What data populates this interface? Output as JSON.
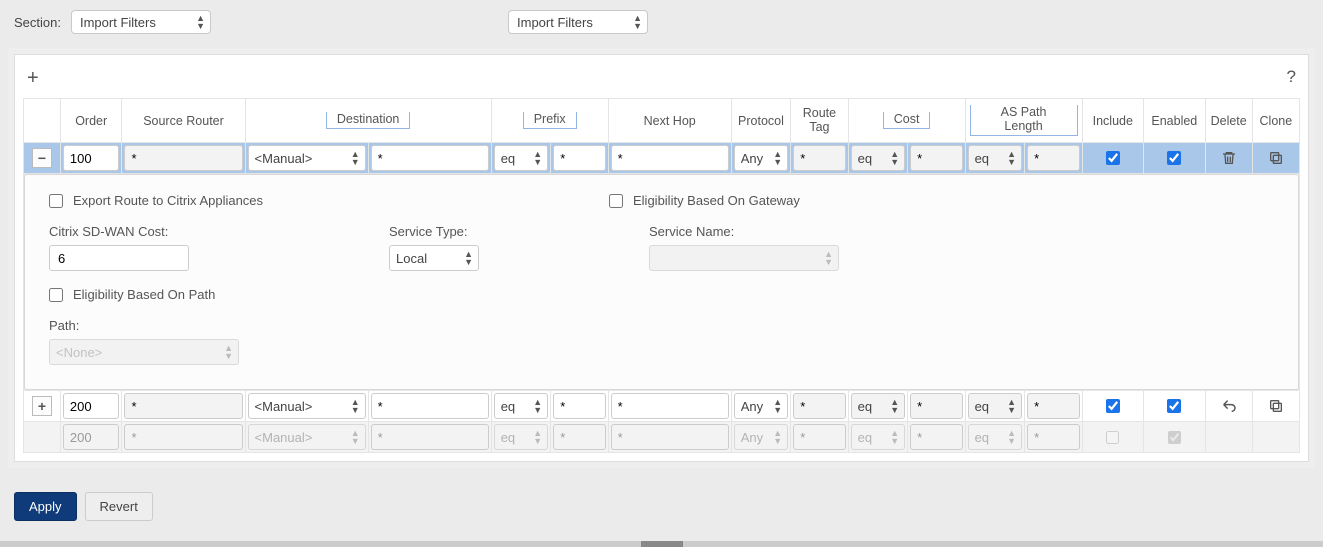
{
  "section": {
    "label": "Section:",
    "select1": "Import Filters",
    "select2": "Import Filters"
  },
  "toolbar": {
    "add": "+",
    "help": "?"
  },
  "headers": {
    "order": "Order",
    "source_router": "Source Router",
    "destination": "Destination",
    "prefix": "Prefix",
    "next_hop": "Next Hop",
    "protocol": "Protocol",
    "route_tag": "Route Tag",
    "cost": "Cost",
    "as_path_length": "AS Path Length",
    "include": "Include",
    "enabled": "Enabled",
    "delete": "Delete",
    "clone": "Clone"
  },
  "rows": [
    {
      "toggle": "−",
      "order": "100",
      "source_router": "*",
      "dest_select": "<Manual>",
      "dest_value": "*",
      "prefix_op": "eq",
      "prefix_val": "*",
      "next_hop": "*",
      "protocol": "Any",
      "route_tag": "*",
      "cost_op": "eq",
      "cost_val": "*",
      "apl_op": "eq",
      "apl_val": "*",
      "include": true,
      "enabled": true
    },
    {
      "toggle": "+",
      "order": "200",
      "source_router": "*",
      "dest_select": "<Manual>",
      "dest_value": "*",
      "prefix_op": "eq",
      "prefix_val": "*",
      "next_hop": "*",
      "protocol": "Any",
      "route_tag": "*",
      "cost_op": "eq",
      "cost_val": "*",
      "apl_op": "eq",
      "apl_val": "*",
      "include": true,
      "enabled": true
    },
    {
      "toggle": "",
      "order": "200",
      "source_router": "*",
      "dest_select": "<Manual>",
      "dest_value": "*",
      "prefix_op": "eq",
      "prefix_val": "*",
      "next_hop": "*",
      "protocol": "Any",
      "route_tag": "*",
      "cost_op": "eq",
      "cost_val": "*",
      "apl_op": "eq",
      "apl_val": "*",
      "include": false,
      "enabled": true
    }
  ],
  "expanded": {
    "export_route": "Export Route to Citrix Appliances",
    "eligibility_gateway": "Eligibility Based On Gateway",
    "cost_label": "Citrix SD-WAN Cost:",
    "cost_value": "6",
    "service_type_label": "Service Type:",
    "service_type": "Local",
    "service_name_label": "Service Name:",
    "eligibility_path": "Eligibility Based On Path",
    "path_label": "Path:",
    "path_value": "<None>"
  },
  "footer": {
    "apply": "Apply",
    "revert": "Revert"
  }
}
